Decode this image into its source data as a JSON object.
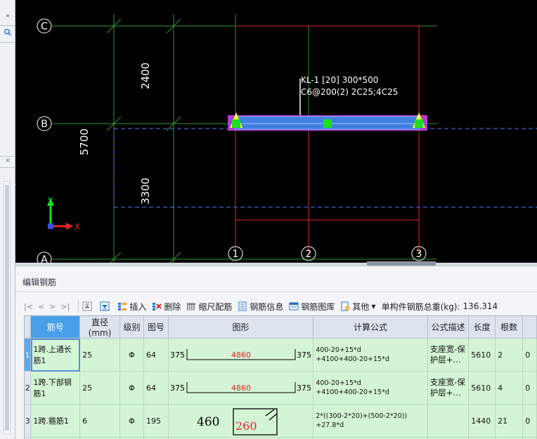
{
  "left_panel": {
    "expand_glyph": "»",
    "search_icon": "search-icon"
  },
  "canvas": {
    "axes_rows": [
      {
        "label": "C"
      },
      {
        "label": "B"
      },
      {
        "label": "A"
      }
    ],
    "axes_cols": [
      {
        "label": "1"
      },
      {
        "label": "2"
      },
      {
        "label": "3"
      }
    ],
    "dimensions": {
      "upper": "2400",
      "lower": "3300",
      "total": "5700"
    },
    "beam_annotation": {
      "line1": "KL-1 [20] 300*500",
      "line2": "C6@200(2) 2C25;4C25"
    },
    "ucs": {
      "y": "Y",
      "x": "X"
    },
    "colors": {
      "background": "#000000",
      "grid_green": "#2e9a2e",
      "column_red": "#e0262b",
      "beam_blue": "#3f7fe0",
      "marker_green": "#1fe01f",
      "marker_yellow": "#ffff33",
      "marker_purple": "#b23ad6",
      "dash_blue": "#3465c8"
    }
  },
  "editor": {
    "title": "编辑钢筋",
    "toolbar": {
      "nav": [
        "|<",
        "<",
        ">",
        ">|"
      ],
      "insert": "插入",
      "delete": "删除",
      "scale_rebar": "缩尺配筋",
      "rebar_info": "钢筋信息",
      "rebar_library": "钢筋图库",
      "other": "其他",
      "total_weight_label": "单构件钢筋总重(kg):",
      "total_weight_value": "136.314"
    },
    "columns": [
      "筋号",
      "直径(mm)",
      "级别",
      "图号",
      "图形",
      "计算公式",
      "公式描述",
      "长度",
      "根数",
      ""
    ],
    "rows": [
      {
        "num": "1",
        "name": "1跨.上通长筋1",
        "diameter": "25",
        "grade": "Φ",
        "figure_no": "64",
        "shape": {
          "left": "375",
          "mid": "4860",
          "right": "375"
        },
        "formula": "400-20+15*d\n+4100+400-20+15*d",
        "desc": "支座宽-保护层+…",
        "length": "5610",
        "count": "2",
        "extra": "0"
      },
      {
        "num": "2",
        "name": "1跨.下部钢筋1",
        "diameter": "25",
        "grade": "Φ",
        "figure_no": "64",
        "shape": {
          "left": "375",
          "mid": "4860",
          "right": "375"
        },
        "formula": "400-20+15*d\n+4100+400-20+15*d",
        "desc": "支座宽-保护层+…",
        "length": "5610",
        "count": "4",
        "extra": "0"
      },
      {
        "num": "3",
        "name": "1跨.箍筋1",
        "diameter": "6",
        "grade": "Φ",
        "figure_no": "195",
        "shape": {
          "left": "460",
          "mid": "260",
          "right": ""
        },
        "formula": "2*((300-2*20)+(500-2*20))\n+27.8*d",
        "desc": "",
        "length": "1440",
        "count": "21",
        "extra": "0"
      }
    ]
  }
}
